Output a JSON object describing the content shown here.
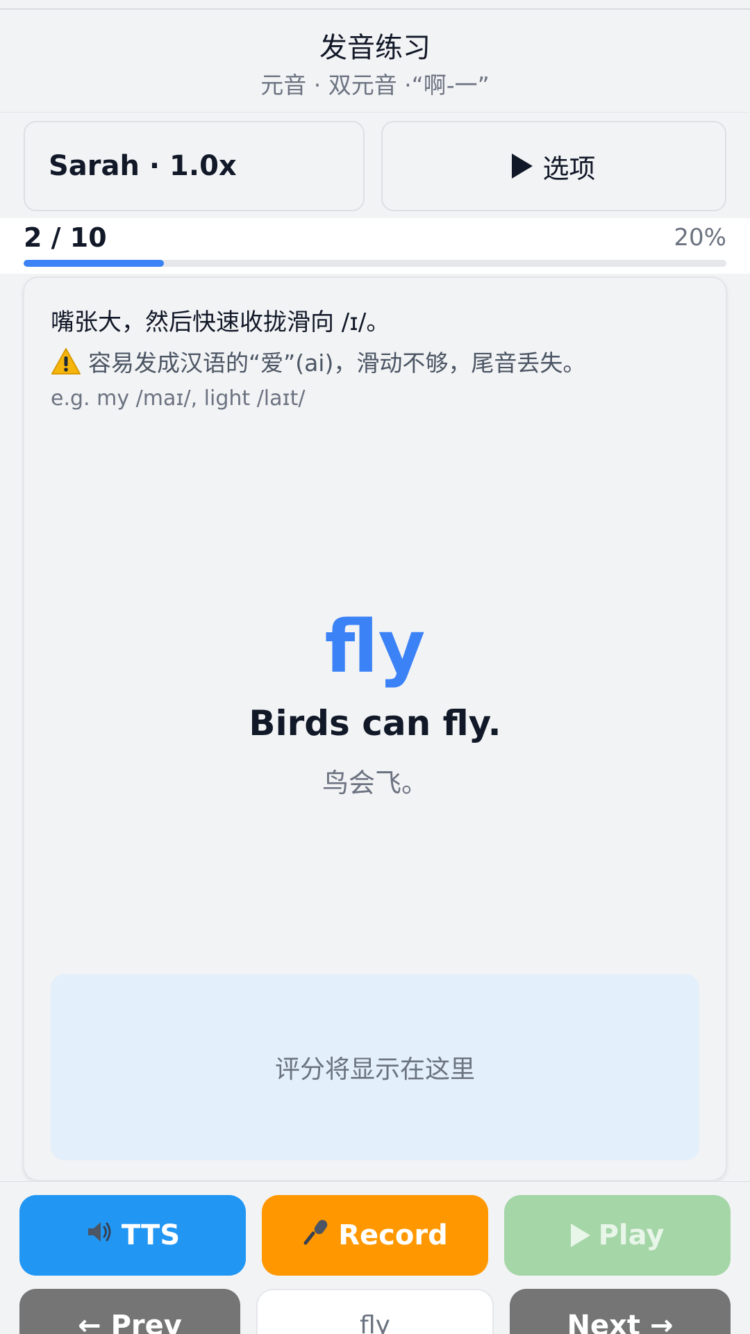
{
  "header": {
    "title": "发音练习",
    "subtitle": "元音 · 双元音 ·“啊-一”"
  },
  "controls": {
    "voice_label": "Sarah · 1.0x",
    "options_label": "选项"
  },
  "progress": {
    "count_label": "2 / 10",
    "percent_label": "20%",
    "value": 0.2,
    "bar_color": "#3b82f6"
  },
  "card": {
    "tip": "嘴张大，然后快速收拢滑向 /ɪ/。",
    "warning_icon": "warning-icon",
    "warning": "容易发成汉语的“爱”(ai)，滑动不够，尾音丢失。",
    "example": "e.g. my /maɪ/, light /laɪt/",
    "word": "fly",
    "sentence": "Birds can fly.",
    "translation": "鸟会飞。",
    "score_placeholder": "评分将显示在这里"
  },
  "actions": {
    "tts_label": "TTS",
    "tts_icon": "speaker-icon",
    "record_label": "Record",
    "record_icon": "microphone-icon",
    "play_label": "Play",
    "play_icon": "play-icon"
  },
  "navigation": {
    "prev_label": "← Prev",
    "word_value": "fly",
    "next_label": "Next →"
  },
  "colors": {
    "accent": "#3b82f6",
    "tts": "#2196f3",
    "record": "#ff9800",
    "play_disabled": "#a5d6a7",
    "nav": "#757575",
    "score_bg": "#e3effb"
  }
}
